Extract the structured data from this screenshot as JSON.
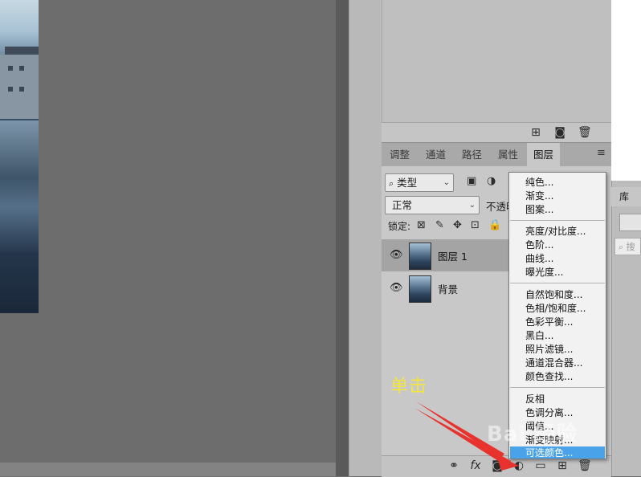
{
  "tabs": [
    {
      "label": "调整",
      "active": false
    },
    {
      "label": "通道",
      "active": false
    },
    {
      "label": "路径",
      "active": false
    },
    {
      "label": "属性",
      "active": false
    },
    {
      "label": "图层",
      "active": true
    }
  ],
  "layers_panel": {
    "filter_kind": "类型",
    "blend_mode": "正常",
    "opacity_label": "不透明",
    "lock_label": "锁定:",
    "layers": [
      {
        "name": "图层 1",
        "visible": true,
        "selected": true
      },
      {
        "name": "背景",
        "visible": true,
        "selected": false
      }
    ]
  },
  "top_toolbar_icons": [
    "new-layer-icon",
    "camera-icon",
    "trash-icon"
  ],
  "bottom_toolbar": {
    "fx_label": "fx",
    "icons": [
      "link-icon",
      "fx-icon",
      "mask-icon",
      "adjustment-icon",
      "group-icon",
      "new-layer-icon",
      "trash-icon"
    ]
  },
  "adjustment_menu": {
    "groups": [
      [
        "纯色...",
        "渐变...",
        "图案..."
      ],
      [
        "亮度/对比度...",
        "色阶...",
        "曲线...",
        "曝光度..."
      ],
      [
        "自然饱和度...",
        "色相/饱和度...",
        "色彩平衡...",
        "黑白...",
        "照片滤镜...",
        "通道混合器...",
        "颜色查找..."
      ],
      [
        "反相",
        "色调分离...",
        "阈值...",
        "渐变映射...",
        "可选颜色..."
      ]
    ],
    "highlighted": "可选颜色..."
  },
  "right_dock": {
    "library_tab": "库",
    "search_placeholder": "搜"
  },
  "annotation": {
    "label": "单击",
    "color": "#f3e63c",
    "arrow_color": "#e8322e"
  },
  "watermark": "Bai 经验"
}
